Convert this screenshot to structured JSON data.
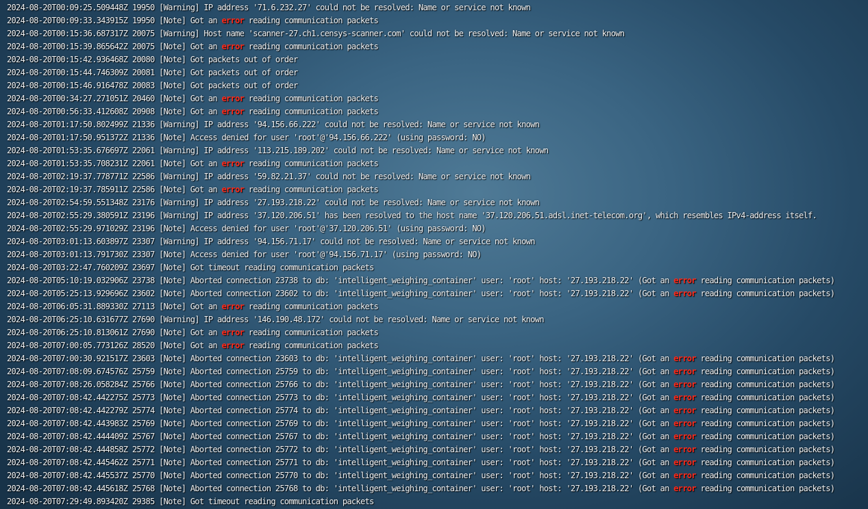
{
  "colors": {
    "text": "#f0f3f5",
    "error_keyword": "#ff2a1a",
    "background": "#3a6482"
  },
  "highlight_word": "error",
  "log_lines": [
    "2024-08-20T00:09:25.509448Z 19950 [Warning] IP address '71.6.232.27' could not be resolved: Name or service not known",
    "2024-08-20T00:09:33.343915Z 19950 [Note] Got an error reading communication packets",
    "2024-08-20T00:15:36.687317Z 20075 [Warning] Host name 'scanner-27.ch1.censys-scanner.com' could not be resolved: Name or service not known",
    "2024-08-20T00:15:39.865642Z 20075 [Note] Got an error reading communication packets",
    "2024-08-20T00:15:42.936468Z 20080 [Note] Got packets out of order",
    "2024-08-20T00:15:44.746309Z 20081 [Note] Got packets out of order",
    "2024-08-20T00:15:46.916478Z 20083 [Note] Got packets out of order",
    "2024-08-20T00:34:27.271051Z 20460 [Note] Got an error reading communication packets",
    "2024-08-20T00:56:33.412608Z 20908 [Note] Got an error reading communication packets",
    "2024-08-20T01:17:50.802499Z 21336 [Warning] IP address '94.156.66.222' could not be resolved: Name or service not known",
    "2024-08-20T01:17:50.951372Z 21336 [Note] Access denied for user 'root'@'94.156.66.222' (using password: NO)",
    "2024-08-20T01:53:35.676697Z 22061 [Warning] IP address '113.215.189.202' could not be resolved: Name or service not known",
    "2024-08-20T01:53:35.708231Z 22061 [Note] Got an error reading communication packets",
    "2024-08-20T02:19:37.778771Z 22586 [Warning] IP address '59.82.21.37' could not be resolved: Name or service not known",
    "2024-08-20T02:19:37.785911Z 22586 [Note] Got an error reading communication packets",
    "2024-08-20T02:54:59.551348Z 23176 [Warning] IP address '27.193.218.22' could not be resolved: Name or service not known",
    "2024-08-20T02:55:29.380591Z 23196 [Warning] IP address '37.120.206.51' has been resolved to the host name '37.120.206.51.adsl.inet-telecom.org', which resembles IPv4-address itself.",
    "2024-08-20T02:55:29.971029Z 23196 [Note] Access denied for user 'root'@'37.120.206.51' (using password: NO)",
    "2024-08-20T03:01:13.603897Z 23307 [Warning] IP address '94.156.71.17' could not be resolved: Name or service not known",
    "2024-08-20T03:01:13.791730Z 23307 [Note] Access denied for user 'root'@'94.156.71.17' (using password: NO)",
    "2024-08-20T03:22:47.760209Z 23697 [Note] Got timeout reading communication packets",
    "2024-08-20T05:10:19.032906Z 23738 [Note] Aborted connection 23738 to db: 'intelligent_weighing_container' user: 'root' host: '27.193.218.22' (Got an error reading communication packets)",
    "2024-08-20T05:25:13.929696Z 23602 [Note] Aborted connection 23602 to db: 'intelligent_weighing_container' user: 'root' host: '27.193.218.22' (Got an error reading communication packets)",
    "2024-08-20T06:05:31.889330Z 27113 [Note] Got an error reading communication packets",
    "2024-08-20T06:25:10.631677Z 27690 [Warning] IP address '146.190.48.172' could not be resolved: Name or service not known",
    "2024-08-20T06:25:10.813061Z 27690 [Note] Got an error reading communication packets",
    "2024-08-20T07:00:05.773126Z 28520 [Note] Got an error reading communication packets",
    "2024-08-20T07:00:30.921517Z 23603 [Note] Aborted connection 23603 to db: 'intelligent_weighing_container' user: 'root' host: '27.193.218.22' (Got an error reading communication packets)",
    "2024-08-20T07:08:09.674576Z 25759 [Note] Aborted connection 25759 to db: 'intelligent_weighing_container' user: 'root' host: '27.193.218.22' (Got an error reading communication packets)",
    "2024-08-20T07:08:26.058284Z 25766 [Note] Aborted connection 25766 to db: 'intelligent_weighing_container' user: 'root' host: '27.193.218.22' (Got an error reading communication packets)",
    "2024-08-20T07:08:42.442275Z 25773 [Note] Aborted connection 25773 to db: 'intelligent_weighing_container' user: 'root' host: '27.193.218.22' (Got an error reading communication packets)",
    "2024-08-20T07:08:42.442279Z 25774 [Note] Aborted connection 25774 to db: 'intelligent_weighing_container' user: 'root' host: '27.193.218.22' (Got an error reading communication packets)",
    "2024-08-20T07:08:42.443983Z 25769 [Note] Aborted connection 25769 to db: 'intelligent_weighing_container' user: 'root' host: '27.193.218.22' (Got an error reading communication packets)",
    "2024-08-20T07:08:42.444409Z 25767 [Note] Aborted connection 25767 to db: 'intelligent_weighing_container' user: 'root' host: '27.193.218.22' (Got an error reading communication packets)",
    "2024-08-20T07:08:42.444858Z 25772 [Note] Aborted connection 25772 to db: 'intelligent_weighing_container' user: 'root' host: '27.193.218.22' (Got an error reading communication packets)",
    "2024-08-20T07:08:42.445462Z 25771 [Note] Aborted connection 25771 to db: 'intelligent_weighing_container' user: 'root' host: '27.193.218.22' (Got an error reading communication packets)",
    "2024-08-20T07:08:42.445537Z 25770 [Note] Aborted connection 25770 to db: 'intelligent_weighing_container' user: 'root' host: '27.193.218.22' (Got an error reading communication packets)",
    "2024-08-20T07:08:42.445618Z 25768 [Note] Aborted connection 25768 to db: 'intelligent_weighing_container' user: 'root' host: '27.193.218.22' (Got an error reading communication packets)",
    "2024-08-20T07:29:49.893420Z 29385 [Note] Got timeout reading communication packets"
  ]
}
